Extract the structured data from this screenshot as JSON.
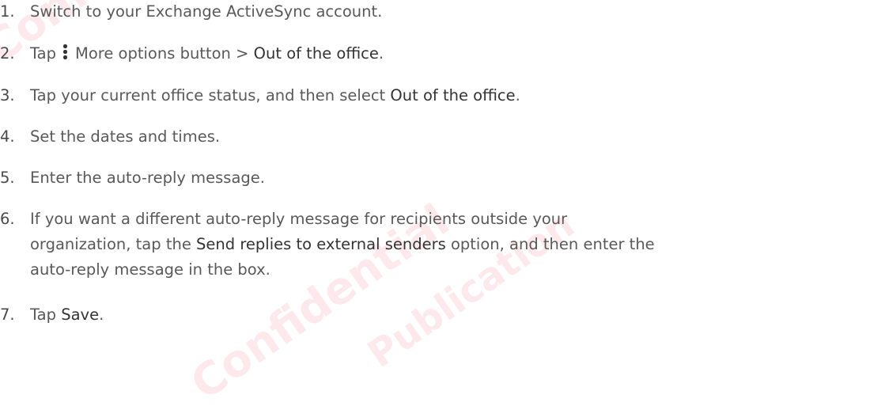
{
  "watermark": {
    "text_1": "Confidential",
    "text_2": "Confidential",
    "text_3": "Publication",
    "color": "#eb283c"
  },
  "steps": [
    {
      "number": "1.",
      "parts": [
        "Switch to your Exchange ActiveSync account."
      ]
    },
    {
      "number": "2.",
      "parts": [
        "Tap",
        "More options button > ",
        "Out of the office",
        "."
      ],
      "icon": "more-options-icon"
    },
    {
      "number": "3.",
      "parts": [
        "Tap your current office status, and then select ",
        "Out of the office",
        "."
      ]
    },
    {
      "number": "4.",
      "parts": [
        "Set the dates and times."
      ]
    },
    {
      "number": "5.",
      "parts": [
        "Enter the auto-reply message."
      ]
    },
    {
      "number": "6.",
      "lines": [
        "If you want a different auto-reply message for recipients outside your",
        "organization, tap the ",
        "Send replies to external senders",
        " option, and then enter the",
        "auto-reply message in the box."
      ]
    },
    {
      "number": "7.",
      "parts": [
        "Tap ",
        "Save",
        "."
      ]
    }
  ]
}
